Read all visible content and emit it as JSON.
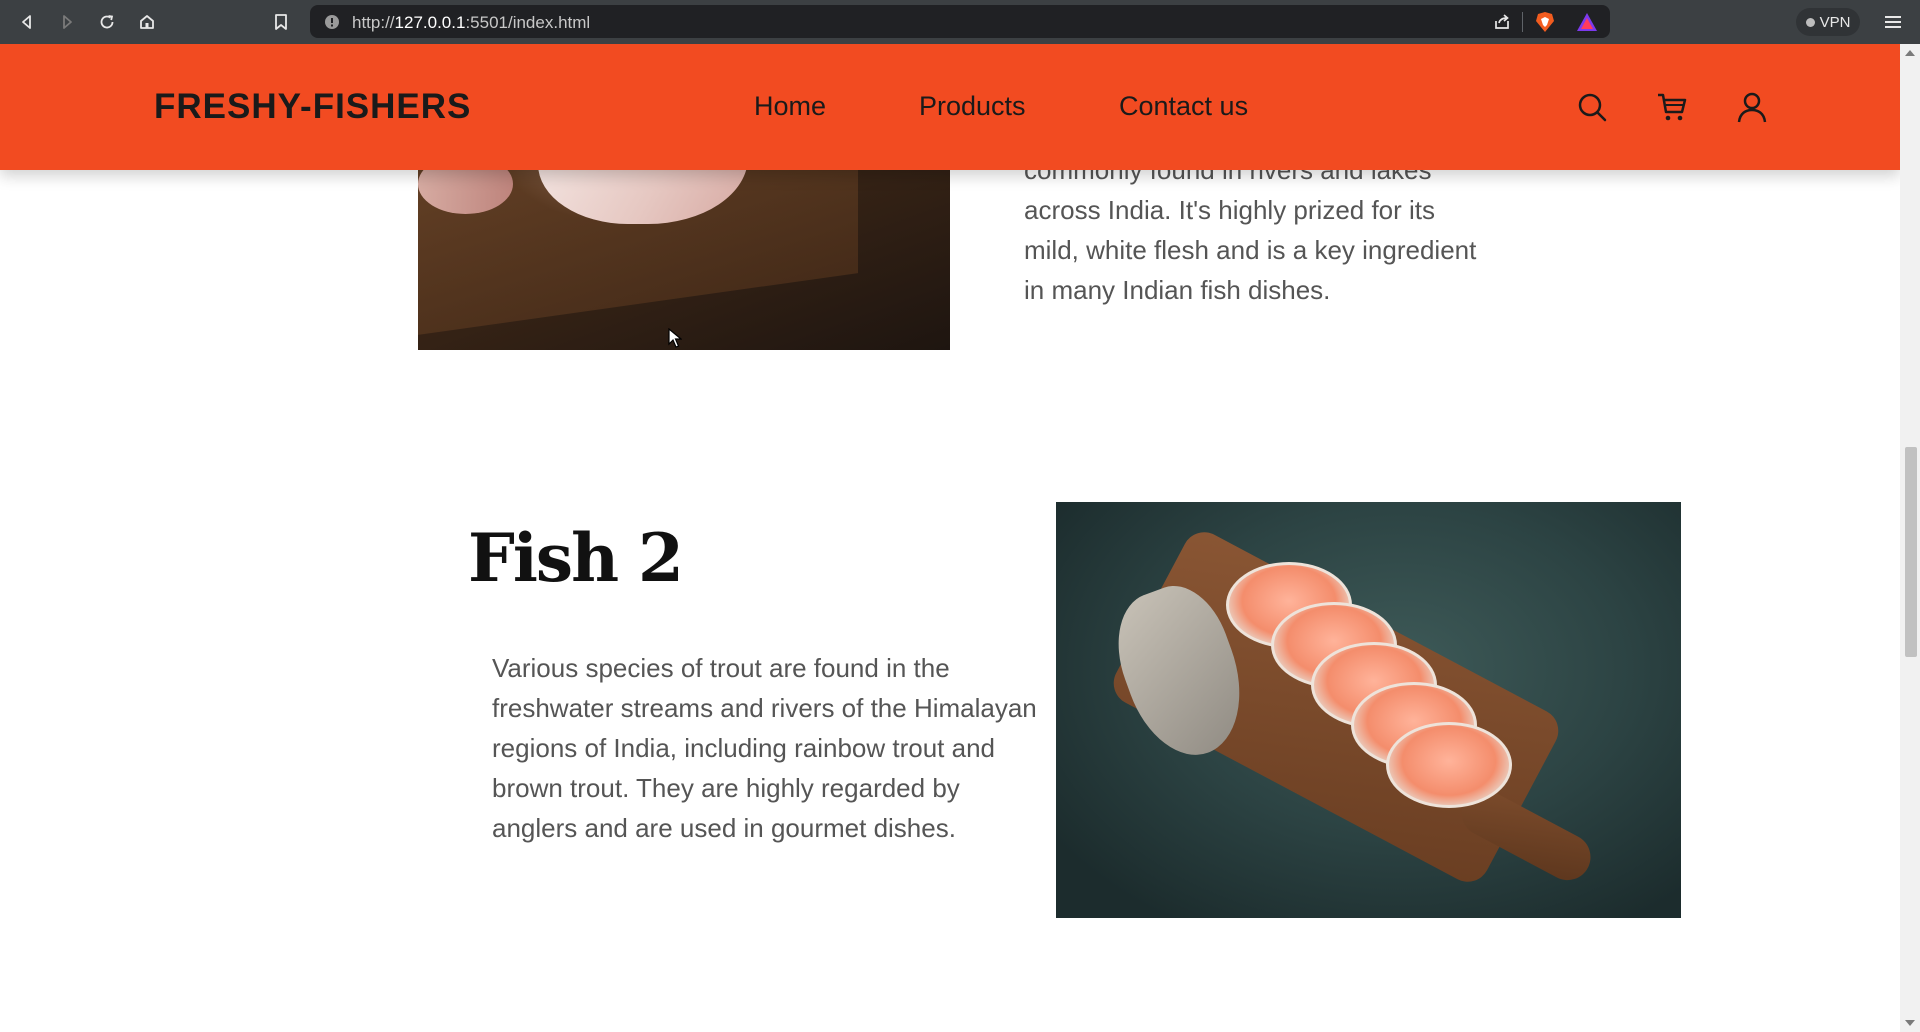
{
  "browser": {
    "url_prefix": "http://",
    "url_host": "127.0.0.1",
    "url_rest": ":5501/index.html",
    "vpn_label": "VPN"
  },
  "header": {
    "brand": "FRESHY-FISHERS",
    "nav": [
      {
        "label": "Home"
      },
      {
        "label": "Products"
      },
      {
        "label": "Contact us"
      }
    ],
    "bg_color": "#f24b21"
  },
  "sections": {
    "fish1_text": "commonly found in rivers and lakes across India. It's highly prized for its mild, white flesh and is a key ingredient in many Indian fish dishes.",
    "fish2_title": "Fish 2",
    "fish2_text": "Various species of trout are found in the freshwater streams and rivers of the Himalayan regions of India, including rainbow trout and brown trout. They are highly regarded by anglers and are used in gourmet dishes."
  }
}
